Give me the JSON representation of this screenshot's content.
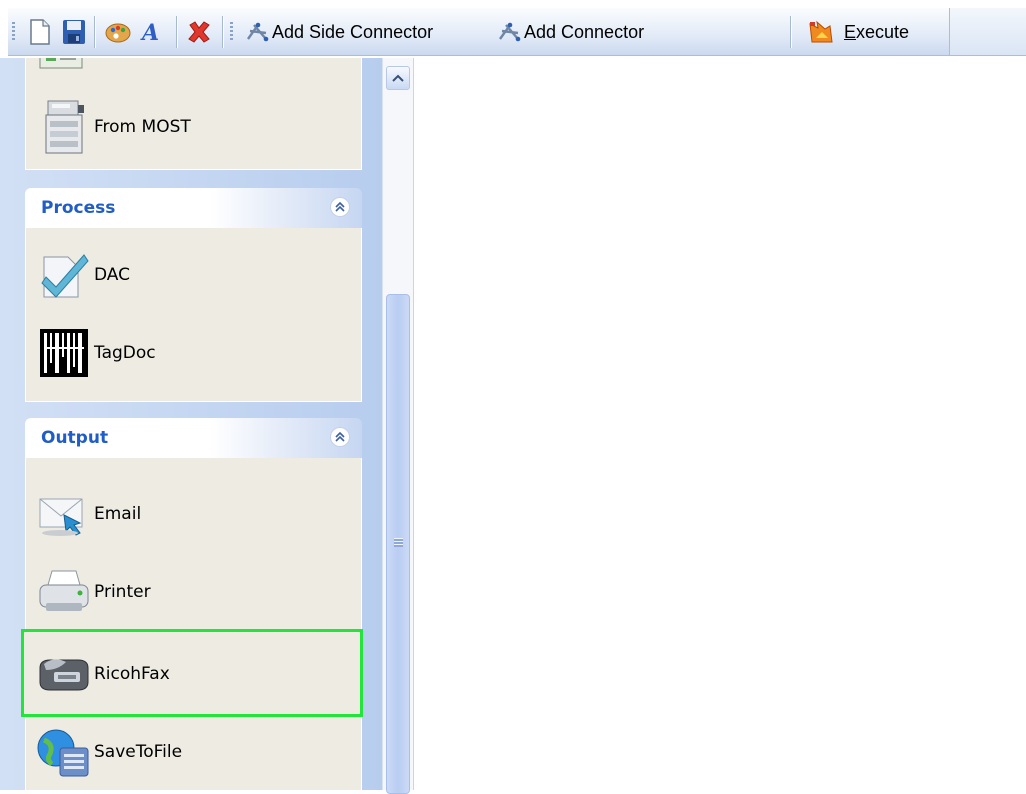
{
  "toolbar": {
    "add_side_connector": "Add Side Connector",
    "add_connector": "Add Connector",
    "execute": "Execute",
    "execute_mnemonic": "E",
    "execute_rest": "xecute"
  },
  "sidebar": {
    "input_items": [
      {
        "label": "From MOST",
        "icon": "mfp-copier-icon"
      }
    ],
    "groups": [
      {
        "title": "Process",
        "items": [
          {
            "label": "DAC",
            "icon": "checkmark-document-icon"
          },
          {
            "label": "TagDoc",
            "icon": "barcode-icon"
          }
        ]
      },
      {
        "title": "Output",
        "items": [
          {
            "label": "Email",
            "icon": "email-icon"
          },
          {
            "label": "Printer",
            "icon": "printer-icon"
          },
          {
            "label": "RicohFax",
            "icon": "fax-icon",
            "selected": true
          },
          {
            "label": "SaveToFile",
            "icon": "globe-file-icon"
          }
        ]
      }
    ]
  },
  "colors": {
    "group_title": "#215dc6",
    "selection_border": "#22e53a",
    "panel_bg": "#eeebe2"
  }
}
